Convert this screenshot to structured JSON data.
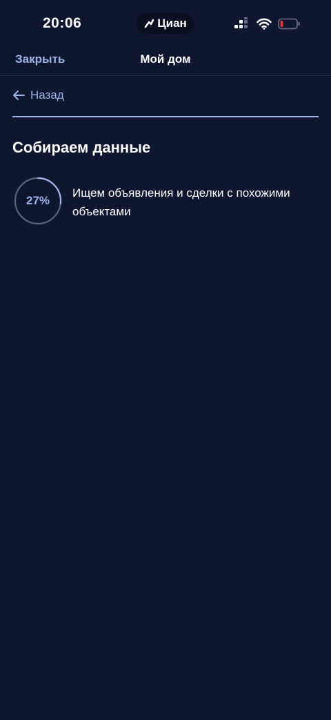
{
  "status_bar": {
    "time": "20:06",
    "island_label": "Циан",
    "battery_color": "#e0353b"
  },
  "nav": {
    "close_label": "Закрыть",
    "title": "Мой дом"
  },
  "back": {
    "label": "Назад"
  },
  "section": {
    "title": "Собираем данные"
  },
  "step": {
    "progress_label": "27%",
    "progress_value": 27,
    "description": "Ищем объявления и сделки с похожими объектами"
  },
  "colors": {
    "background": "#0f1630",
    "accent": "#9fb4ea",
    "ring_track": "#5b6378"
  }
}
